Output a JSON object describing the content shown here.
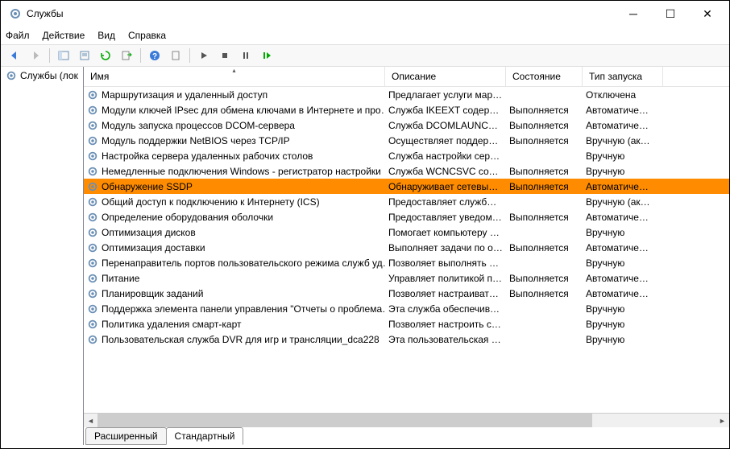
{
  "title": "Службы",
  "menu": {
    "file": "Файл",
    "action": "Действие",
    "view": "Вид",
    "help": "Справка"
  },
  "tree": {
    "root": "Службы (лок"
  },
  "columns": {
    "name": "Имя",
    "desc": "Описание",
    "state": "Состояние",
    "start": "Тип запуска"
  },
  "tabs": {
    "ext": "Расширенный",
    "std": "Стандартный"
  },
  "services": [
    {
      "name": "Маршрутизация и удаленный доступ",
      "desc": "Предлагает услуги мар…",
      "state": "",
      "start": "Отключена",
      "selected": false
    },
    {
      "name": "Модули ключей IPsec для обмена ключами в Интернете и про…",
      "desc": "Служба IKEEXT содержи…",
      "state": "Выполняется",
      "start": "Автоматиче…",
      "selected": false
    },
    {
      "name": "Модуль запуска процессов DCOM-сервера",
      "desc": "Служба DCOMLAUNCH …",
      "state": "Выполняется",
      "start": "Автоматиче…",
      "selected": false
    },
    {
      "name": "Модуль поддержки NetBIOS через TCP/IP",
      "desc": "Осуществляет поддерж…",
      "state": "Выполняется",
      "start": "Вручную (ак…",
      "selected": false
    },
    {
      "name": "Настройка сервера удаленных рабочих столов",
      "desc": "Служба настройки серв…",
      "state": "",
      "start": "Вручную",
      "selected": false
    },
    {
      "name": "Немедленные подключения Windows - регистратор настройки",
      "desc": "Служба WCNCSVC соде…",
      "state": "Выполняется",
      "start": "Вручную",
      "selected": false
    },
    {
      "name": "Обнаружение SSDP",
      "desc": "Обнаруживает сетевые …",
      "state": "Выполняется",
      "start": "Автоматиче…",
      "selected": true
    },
    {
      "name": "Общий доступ к подключению к Интернету (ICS)",
      "desc": "Предоставляет службы …",
      "state": "",
      "start": "Вручную (ак…",
      "selected": false
    },
    {
      "name": "Определение оборудования оболочки",
      "desc": "Предоставляет уведомл…",
      "state": "Выполняется",
      "start": "Автоматиче…",
      "selected": false
    },
    {
      "name": "Оптимизация дисков",
      "desc": "Помогает компьютеру …",
      "state": "",
      "start": "Вручную",
      "selected": false
    },
    {
      "name": "Оптимизация доставки",
      "desc": "Выполняет задачи по о…",
      "state": "Выполняется",
      "start": "Автоматиче…",
      "selected": false
    },
    {
      "name": "Перенаправитель портов пользовательского режима служб уд…",
      "desc": "Позволяет выполнять п…",
      "state": "",
      "start": "Вручную",
      "selected": false
    },
    {
      "name": "Питание",
      "desc": "Управляет политикой п…",
      "state": "Выполняется",
      "start": "Автоматиче…",
      "selected": false
    },
    {
      "name": "Планировщик заданий",
      "desc": "Позволяет настраивать …",
      "state": "Выполняется",
      "start": "Автоматиче…",
      "selected": false
    },
    {
      "name": "Поддержка элемента панели управления \"Отчеты о проблема…",
      "desc": "Эта служба обеспечива…",
      "state": "",
      "start": "Вручную",
      "selected": false
    },
    {
      "name": "Политика удаления смарт-карт",
      "desc": "Позволяет настроить си…",
      "state": "",
      "start": "Вручную",
      "selected": false
    },
    {
      "name": "Пользовательская служба DVR для игр и трансляции_dca228",
      "desc": "Эта пользовательская с…",
      "state": "",
      "start": "Вручную",
      "selected": false
    }
  ]
}
